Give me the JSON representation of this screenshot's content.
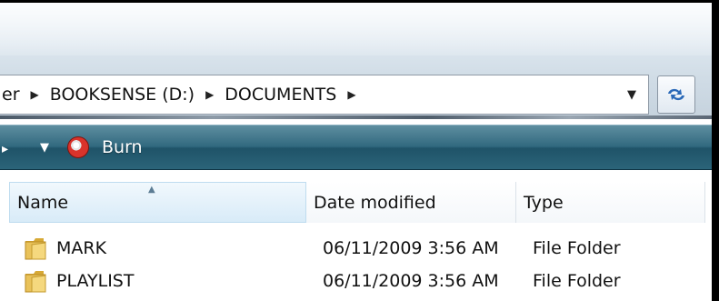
{
  "address_bar": {
    "partial_crumb": "er",
    "crumbs": [
      "BOOKSENSE (D:)",
      "DOCUMENTS"
    ]
  },
  "toolbar": {
    "burn_label": "Burn"
  },
  "columns": {
    "name": "Name",
    "date_modified": "Date modified",
    "type": "Type"
  },
  "files": [
    {
      "name": "MARK",
      "date_modified": "06/11/2009 3:56 AM",
      "type": "File Folder",
      "icon": "folder-icon"
    },
    {
      "name": "PLAYLIST",
      "date_modified": "06/11/2009 3:56 AM",
      "type": "File Folder",
      "icon": "folder-icon"
    }
  ],
  "colors": {
    "toolbar": "#2b6479",
    "header_selected": "#d8ebf8",
    "burn_icon": "#d9332b",
    "folder": "#e9c25a"
  }
}
